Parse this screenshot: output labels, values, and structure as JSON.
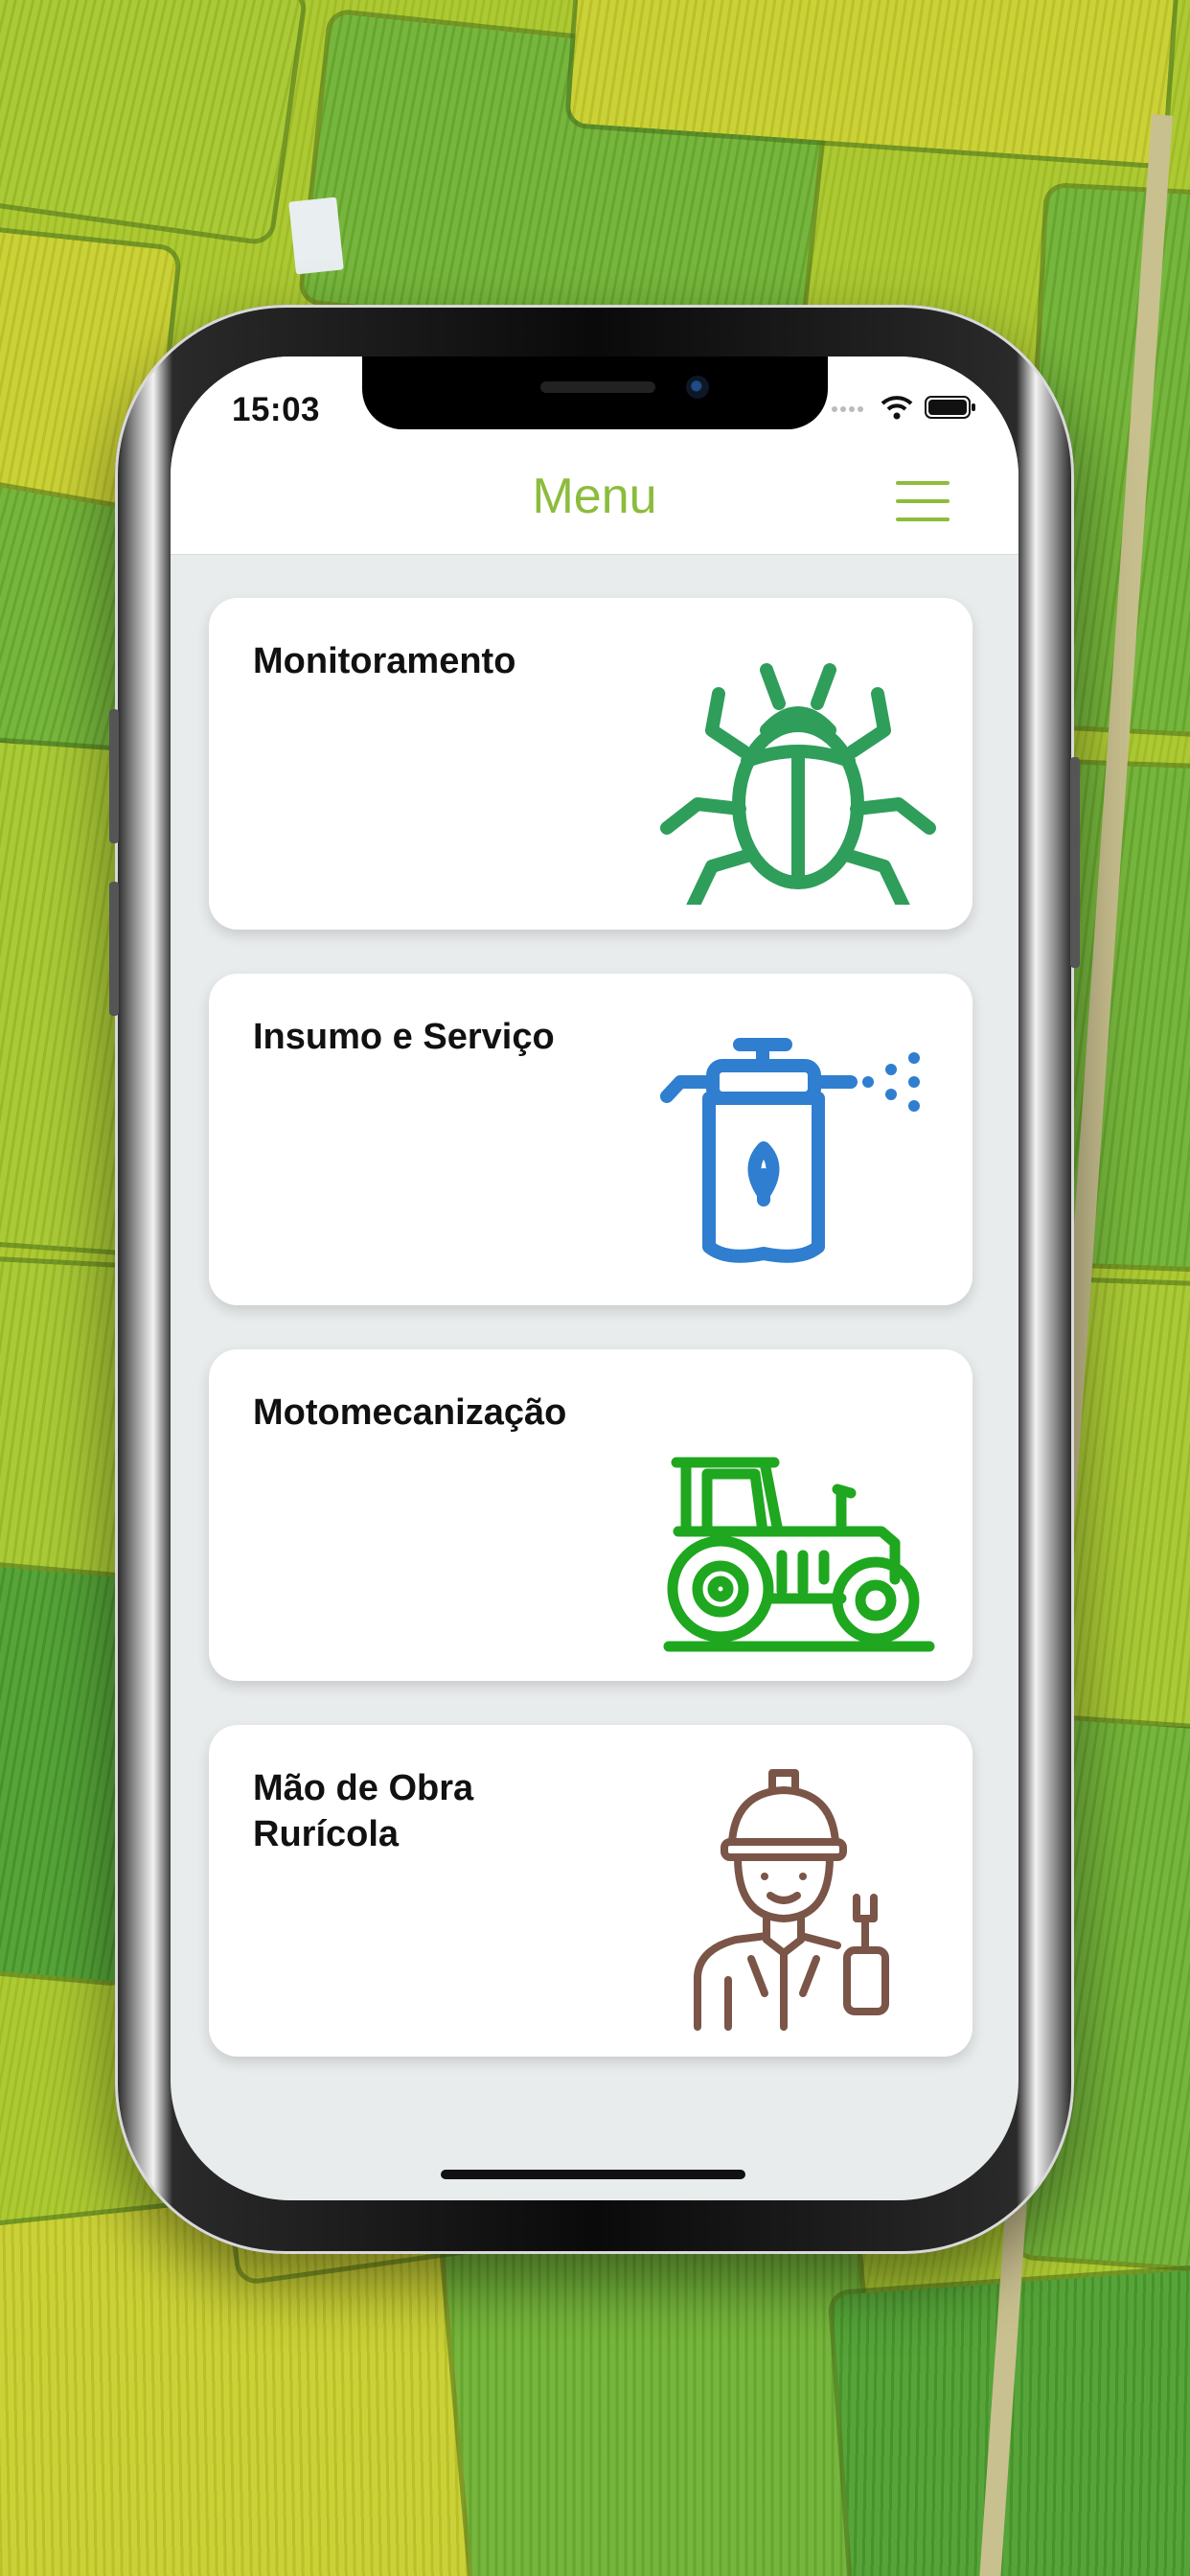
{
  "status_bar": {
    "time": "15:03"
  },
  "header": {
    "title": "Menu"
  },
  "cards": [
    {
      "label": "Monitoramento",
      "icon": "beetle-icon"
    },
    {
      "label": "Insumo e Serviço",
      "icon": "sprayer-icon"
    },
    {
      "label": "Motomecanização",
      "icon": "tractor-icon"
    },
    {
      "label": "Mão de Obra Rurícola",
      "icon": "worker-icon"
    }
  ],
  "colors": {
    "header_accent": "#8CBC3C",
    "monitoramento_icon": "#2E9E5A",
    "insumo_icon": "#2F7ED0",
    "moto_icon": "#1FA71F",
    "worker_icon": "#7A5548",
    "screen_background": "#E9ECED"
  }
}
